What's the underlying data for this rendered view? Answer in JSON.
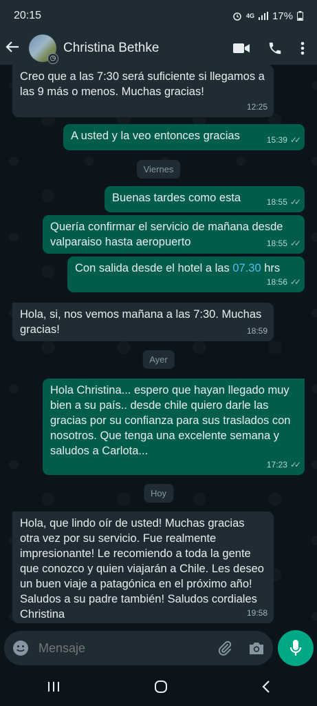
{
  "status_bar": {
    "time": "20:15",
    "network": "4G",
    "battery": "17%"
  },
  "header": {
    "contact_name": "Christina Bethke",
    "back_icon": "arrow-left-icon",
    "video_icon": "video-camera-icon",
    "call_icon": "phone-icon",
    "menu_icon": "more-vertical-icon"
  },
  "messages": [
    {
      "direction": "in",
      "text": "Creo que a las 7:30 será suficiente si llegamos a las 9 más o menos. Muchas gracias!",
      "time": "12:25"
    },
    {
      "direction": "out",
      "text": "A usted y la veo entonces gracias",
      "time": "15:39"
    },
    {
      "direction": "out",
      "text": "Buenas tardes como esta",
      "time": "18:55"
    },
    {
      "direction": "out",
      "text": "Quería confirmar el servicio de mañana desde valparaiso hasta aeropuerto",
      "time": "18:55"
    },
    {
      "direction": "out",
      "text_before": "Con salida desde el hotel a las ",
      "text_link": "07.30",
      "text_after": " hrs",
      "time": "18:56"
    },
    {
      "direction": "in",
      "text": "Hola, si, nos vemos mañana a las 7:30. Muchas gracias!",
      "time": "18:59"
    },
    {
      "direction": "out",
      "text": "Hola Christina... espero que hayan llegado muy bien a su país..  desde chile quiero darle las gracias por su confianza para sus traslados con nosotros. Que tenga una excelente semana y saludos a Carlota...",
      "time": "17:23"
    },
    {
      "direction": "in",
      "text": "Hola, que lindo oír de usted! Muchas gracias otra vez por su servicio. Fue realmente impresionante! Le recomiendo a toda la gente que conozco y quien viajarán a Chile. Les deseo un buen viaje a patagónica en el próximo año! Saludos a su padre también! Saludos cordiales Christina",
      "time": "19:58"
    }
  ],
  "day_separators": [
    "Viernes",
    "Ayer",
    "Hoy"
  ],
  "composer": {
    "placeholder": "Mensaje"
  },
  "colors": {
    "incoming": "#1f2c34",
    "outgoing": "#005c4b",
    "accent": "#00a884",
    "link": "#53bdeb"
  }
}
